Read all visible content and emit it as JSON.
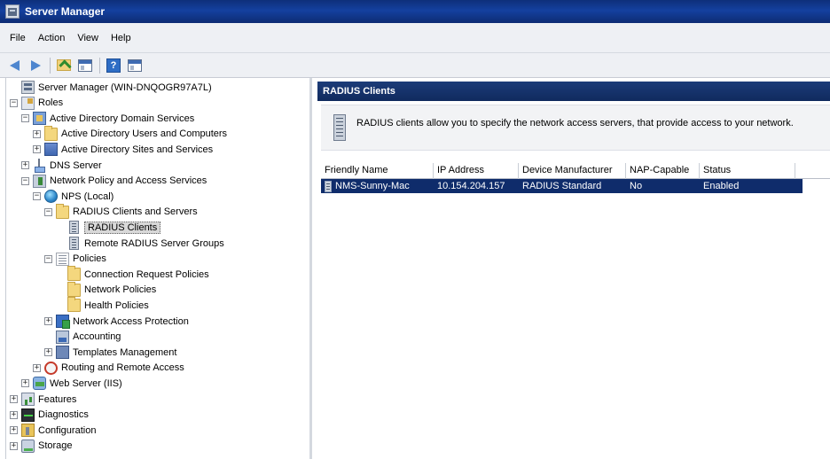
{
  "window": {
    "title": "Server Manager"
  },
  "menu": [
    "File",
    "Action",
    "View",
    "Help"
  ],
  "toolbar": [
    "back-icon",
    "forward-icon",
    "up-folder-icon",
    "show-hide-console-tree-icon",
    "help-icon",
    "show-hide-action-pane-icon"
  ],
  "tree": [
    {
      "label": "Server Manager (WIN-DNQOGR97A7L)",
      "icon": "server",
      "level": 0,
      "expander": ""
    },
    {
      "label": "Roles",
      "icon": "roles",
      "level": 0,
      "expander": "−"
    },
    {
      "label": "Active Directory Domain Services",
      "icon": "ad",
      "level": 1,
      "expander": "−"
    },
    {
      "label": "Active Directory Users and Computers",
      "icon": "folder",
      "level": 2,
      "expander": "+"
    },
    {
      "label": "Active Directory Sites and Services",
      "icon": "sites",
      "level": 2,
      "expander": "+"
    },
    {
      "label": "DNS Server",
      "icon": "dns",
      "level": 1,
      "expander": "+"
    },
    {
      "label": "Network Policy and Access Services",
      "icon": "npas",
      "level": 1,
      "expander": "−"
    },
    {
      "label": "NPS (Local)",
      "icon": "globe",
      "level": 2,
      "expander": "−"
    },
    {
      "label": "RADIUS Clients and Servers",
      "icon": "folder",
      "level": 3,
      "expander": "−"
    },
    {
      "label": "RADIUS Clients",
      "icon": "device",
      "level": 4,
      "expander": "",
      "selected": true
    },
    {
      "label": "Remote RADIUS Server Groups",
      "icon": "device",
      "level": 4,
      "expander": ""
    },
    {
      "label": "Policies",
      "icon": "policy",
      "level": 3,
      "expander": "−"
    },
    {
      "label": "Connection Request Policies",
      "icon": "folder",
      "level": 4,
      "expander": ""
    },
    {
      "label": "Network Policies",
      "icon": "folder",
      "level": 4,
      "expander": ""
    },
    {
      "label": "Health Policies",
      "icon": "folder",
      "level": 4,
      "expander": ""
    },
    {
      "label": "Network Access Protection",
      "icon": "nap",
      "level": 3,
      "expander": "+"
    },
    {
      "label": "Accounting",
      "icon": "acct",
      "level": 3,
      "expander": ""
    },
    {
      "label": "Templates Management",
      "icon": "tmpl",
      "level": 3,
      "expander": "+"
    },
    {
      "label": "Routing and Remote Access",
      "icon": "route",
      "level": 2,
      "expander": "+"
    },
    {
      "label": "Web Server (IIS)",
      "icon": "web",
      "level": 1,
      "expander": "+"
    },
    {
      "label": "Features",
      "icon": "feat",
      "level": 0,
      "expander": "+"
    },
    {
      "label": "Diagnostics",
      "icon": "diag",
      "level": 0,
      "expander": "+"
    },
    {
      "label": "Configuration",
      "icon": "config",
      "level": 0,
      "expander": "+"
    },
    {
      "label": "Storage",
      "icon": "storage",
      "level": 0,
      "expander": "+"
    }
  ],
  "right_pane": {
    "title": "RADIUS Clients",
    "info": "RADIUS clients allow you to specify the network access servers, that provide access to your network.",
    "columns": [
      "Friendly Name",
      "IP Address",
      "Device Manufacturer",
      "NAP-Capable",
      "Status",
      ""
    ],
    "rows": [
      [
        "NMS-Sunny-Mac",
        "10.154.204.157",
        "RADIUS Standard",
        "No",
        "Enabled"
      ]
    ]
  },
  "colors": {
    "selection": "#0f2c6b",
    "header_bar": "#1c3c79",
    "title_bar": "#14409f"
  }
}
